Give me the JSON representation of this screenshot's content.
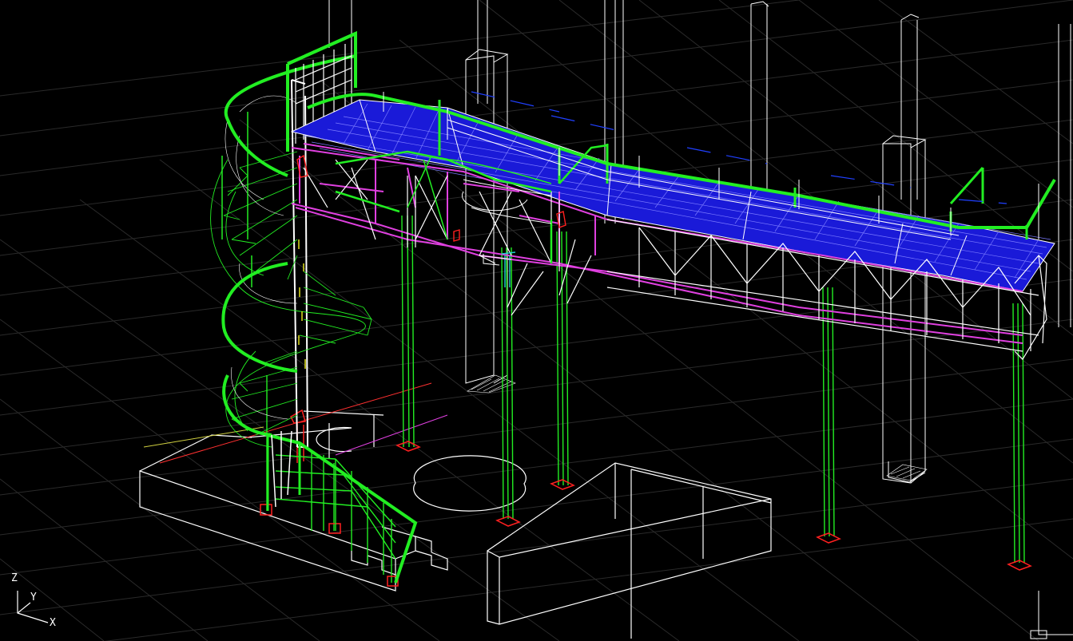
{
  "viewport": {
    "background_color": "#000000",
    "grid_color": "#2a2a2a",
    "colors": {
      "structure": "#ffffff",
      "handrail": "#22ee22",
      "deck_grating": "#2020e0",
      "deck_grating_lines": "#7a7aff",
      "beams": "#e040e0",
      "base_plates": "#ff2020",
      "accent_cyan": "#20d0d0",
      "accent_yellow": "#f0f020"
    }
  },
  "ucs_icon": {
    "axis_z": "Z",
    "axis_y": "Y",
    "axis_x": "X"
  }
}
